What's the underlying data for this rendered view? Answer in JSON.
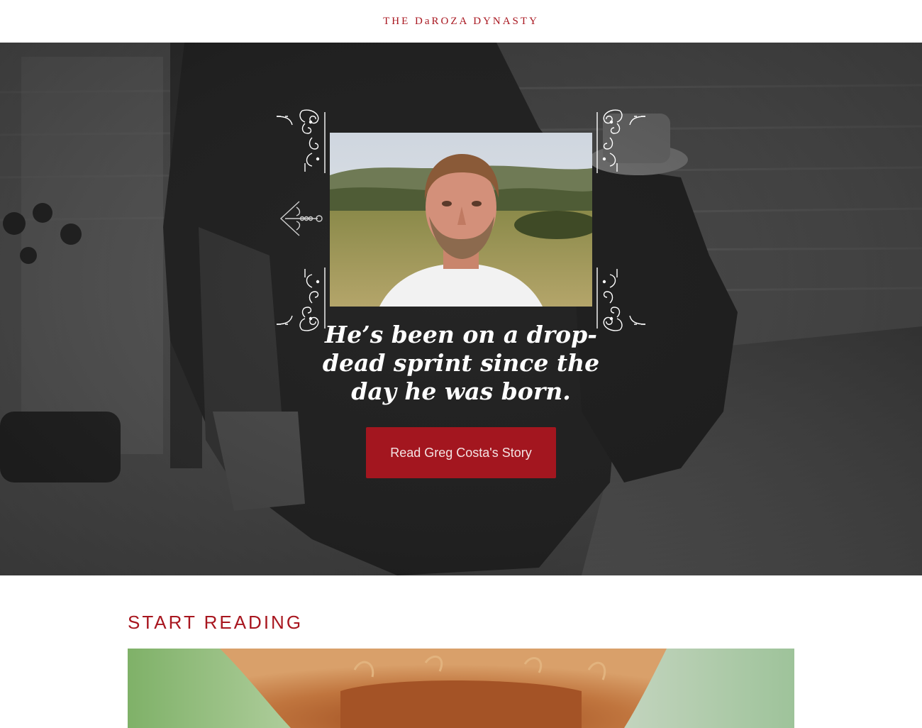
{
  "header": {
    "site_title": "THE DaROZA DYNASTY"
  },
  "hero": {
    "quote": "He’s been on a drop-dead sprint since the day he was born.",
    "cta_label": "Read Greg Costa's Story",
    "prev_icon": "ornate-left-arrow-icon"
  },
  "colors": {
    "brand_red": "#a8161f",
    "button_red": "#a3161f"
  },
  "section": {
    "title": "START READING"
  }
}
